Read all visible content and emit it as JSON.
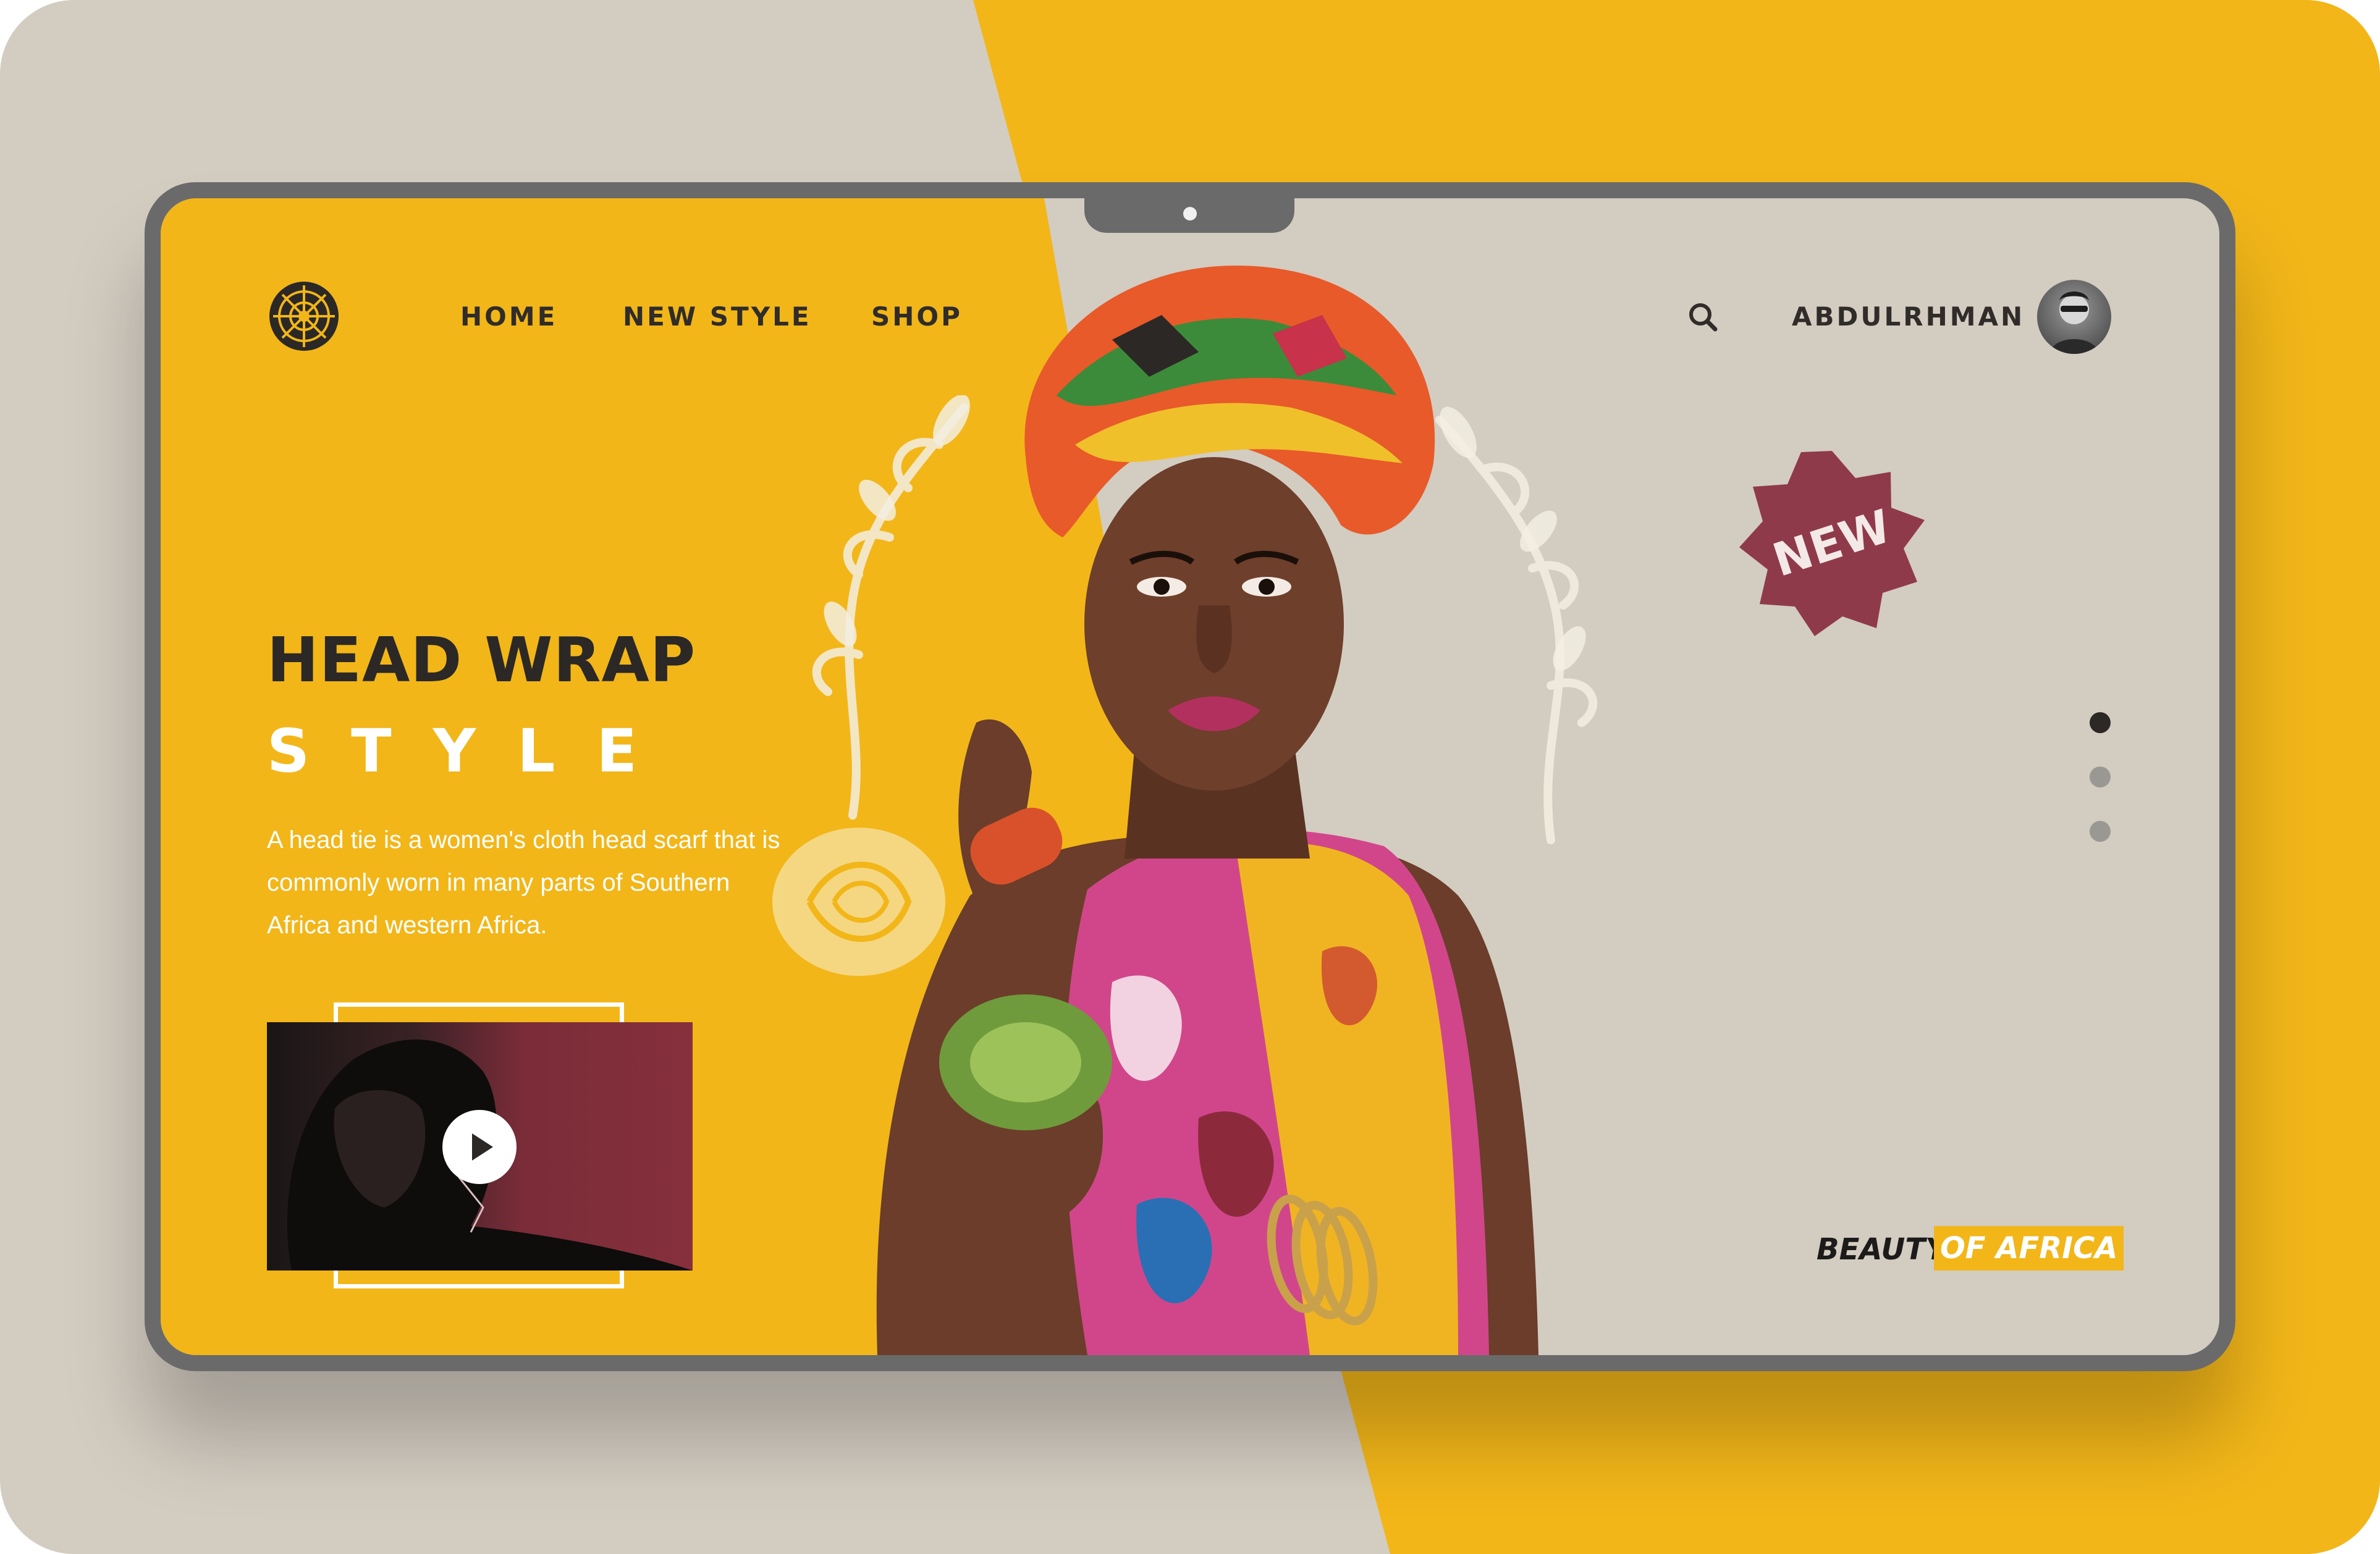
{
  "colors": {
    "accent_yellow": "#f2b619",
    "background_beige": "#d3ccc1",
    "device_frame": "#6a6a6a",
    "badge_maroon": "#8f3a4a",
    "text_dark": "#2b2826"
  },
  "header": {
    "logo_icon": "mandala-logo-icon",
    "nav": [
      {
        "label": "HOME"
      },
      {
        "label": "NEW STYLE"
      },
      {
        "label": "SHOP"
      }
    ],
    "search_icon": "search-icon",
    "user_name": "ABDULRHMAN",
    "avatar_icon": "user-avatar"
  },
  "hero": {
    "title_line1": "HEAD WRAP",
    "title_line2": "STYLE",
    "description": "A head tie is a women's cloth head scarf that is commonly worn in many parts of Southern Africa and western Africa.",
    "video_play_icon": "play-icon",
    "badge_text": "NEW"
  },
  "slider": {
    "count": 3,
    "active_index": 0
  },
  "tagline": {
    "part1": "BEAUTY",
    "part2": "OF AFRICA"
  }
}
